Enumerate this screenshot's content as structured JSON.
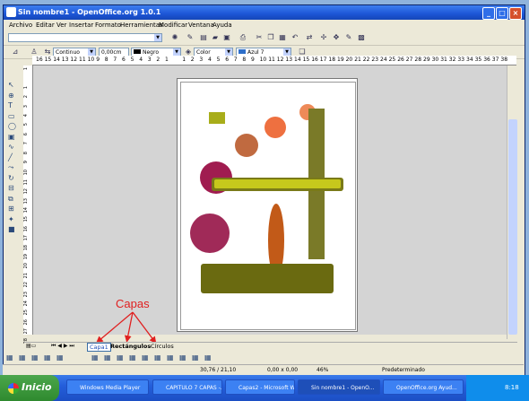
{
  "window": {
    "title": "Sin nombre1 - OpenOffice.org 1.0.1"
  },
  "menu": [
    "Archivo",
    "Editar",
    "Ver",
    "Insertar",
    "Formato",
    "Herramientas",
    "Modificar",
    "Ventana",
    "Ayuda"
  ],
  "toolbar2": {
    "line_style": "Continuo",
    "line_width": "0,00cm",
    "line_color": "Negro",
    "fill_type": "Color",
    "fill_color": "Azul 7"
  },
  "ruler_h": [
    "16",
    "15",
    "14",
    "13",
    "12",
    "11",
    "10",
    "9",
    "8",
    "7",
    "6",
    "5",
    "4",
    "3",
    "2",
    "1",
    "",
    "1",
    "2",
    "3",
    "4",
    "5",
    "6",
    "7",
    "8",
    "9",
    "10",
    "11",
    "12",
    "13",
    "14",
    "15",
    "16",
    "17",
    "18",
    "19",
    "20",
    "21",
    "22",
    "23",
    "24",
    "25",
    "26",
    "27",
    "28",
    "29",
    "30",
    "31",
    "32",
    "33",
    "34",
    "35",
    "36",
    "37",
    "38"
  ],
  "ruler_v": [
    "1",
    "",
    "1",
    "2",
    "3",
    "4",
    "5",
    "6",
    "7",
    "8",
    "9",
    "10",
    "11",
    "12",
    "13",
    "14",
    "15",
    "16",
    "17",
    "18",
    "19",
    "20",
    "21",
    "22",
    "23",
    "24",
    "25",
    "26",
    "27",
    "28"
  ],
  "annotation": "Capas",
  "tabs": [
    {
      "label": "Capa1"
    },
    {
      "label": "Rectángulos"
    },
    {
      "label": "Círculos"
    }
  ],
  "status": {
    "position": "30,76 / 21,10",
    "size": "0,00 x 0,00",
    "zoom": "46%",
    "page_style": "Predeterminado"
  },
  "taskbar": {
    "start": "Inicio",
    "tasks": [
      "Windows Media Player",
      "CAPITULO 7 CAPAS -...",
      "Capas2 - Microsoft W...",
      "Sin nombre1 - OpenO...",
      "OpenOffice.org Ayud..."
    ],
    "clock": "8:18"
  },
  "colors": {
    "olive": "#7a7a28",
    "lime": "#a8ad1a",
    "crimson": "#a01c50",
    "rust": "#c25a18",
    "terracotta": "#c06a40",
    "salmon": "#ee8a58",
    "dark_olive": "#6a6a10",
    "annotation_red": "#e02020"
  }
}
